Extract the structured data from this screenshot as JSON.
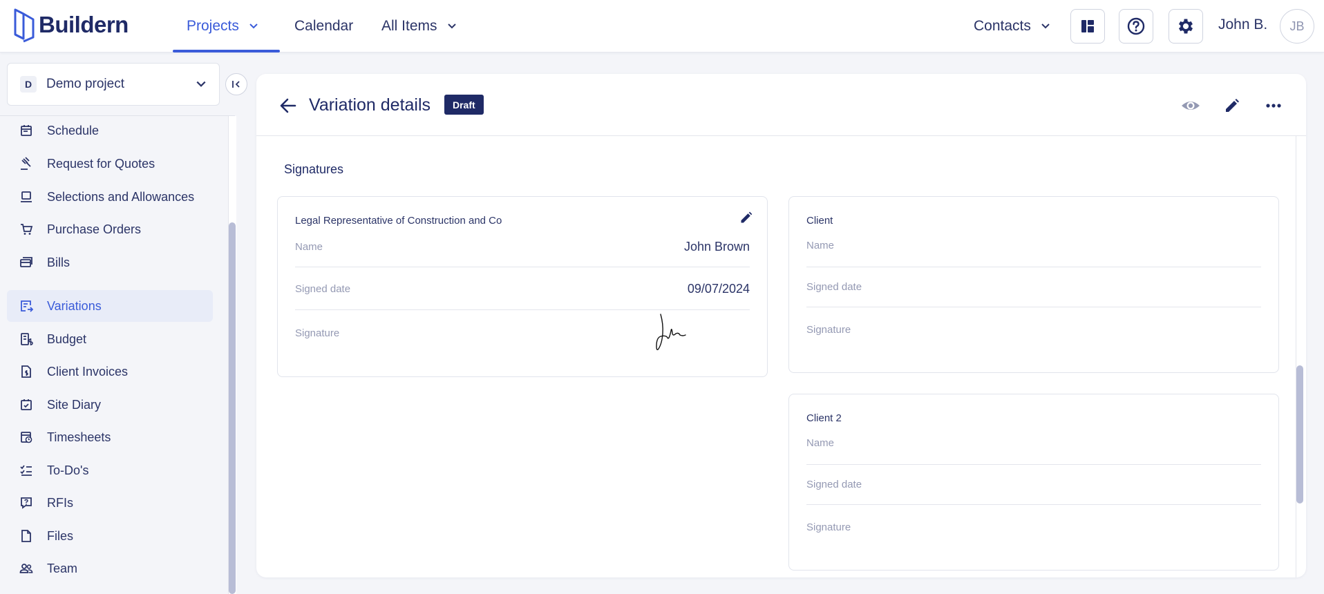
{
  "app": {
    "brand": "Buildern"
  },
  "nav": {
    "projects": "Projects",
    "calendar": "Calendar",
    "all_items": "All Items",
    "contacts": "Contacts"
  },
  "user": {
    "name": "John B.",
    "initials": "JB"
  },
  "project": {
    "badge": "D",
    "name": "Demo project"
  },
  "sidebar": {
    "items": [
      {
        "label": "Schedule",
        "icon": "calendar-icon"
      },
      {
        "label": "Request for Quotes",
        "icon": "gavel-icon"
      },
      {
        "label": "Selections and Allowances",
        "icon": "selections-icon"
      },
      {
        "label": "Purchase Orders",
        "icon": "cart-icon"
      },
      {
        "label": "Bills",
        "icon": "bills-icon"
      },
      {
        "label": "Variations",
        "icon": "variations-icon",
        "active": true
      },
      {
        "label": "Budget",
        "icon": "budget-icon"
      },
      {
        "label": "Client Invoices",
        "icon": "invoice-icon"
      },
      {
        "label": "Site Diary",
        "icon": "site-diary-icon"
      },
      {
        "label": "Timesheets",
        "icon": "timesheet-icon"
      },
      {
        "label": "To-Do's",
        "icon": "todo-icon"
      },
      {
        "label": "RFIs",
        "icon": "rfi-icon"
      },
      {
        "label": "Files",
        "icon": "file-icon"
      },
      {
        "label": "Team",
        "icon": "team-icon"
      }
    ]
  },
  "page": {
    "title": "Variation details",
    "status": "Draft",
    "section_title": "Signatures"
  },
  "signatures": [
    {
      "heading": "Legal Representative of Construction and Co",
      "name_label": "Name",
      "name_value": "John Brown",
      "date_label": "Signed date",
      "date_value": "09/07/2024",
      "signature_label": "Signature"
    },
    {
      "heading": "Client",
      "name_label": "Name",
      "name_value": "",
      "date_label": "Signed date",
      "date_value": "",
      "signature_label": "Signature"
    },
    {
      "heading": "Client 2",
      "name_label": "Name",
      "name_value": "",
      "date_label": "Signed date",
      "date_value": "",
      "signature_label": "Signature"
    }
  ],
  "colors": {
    "brand": "#1f2a66",
    "accent": "#3a5bd9",
    "text": "#2b3467",
    "muted": "#9499b3"
  }
}
